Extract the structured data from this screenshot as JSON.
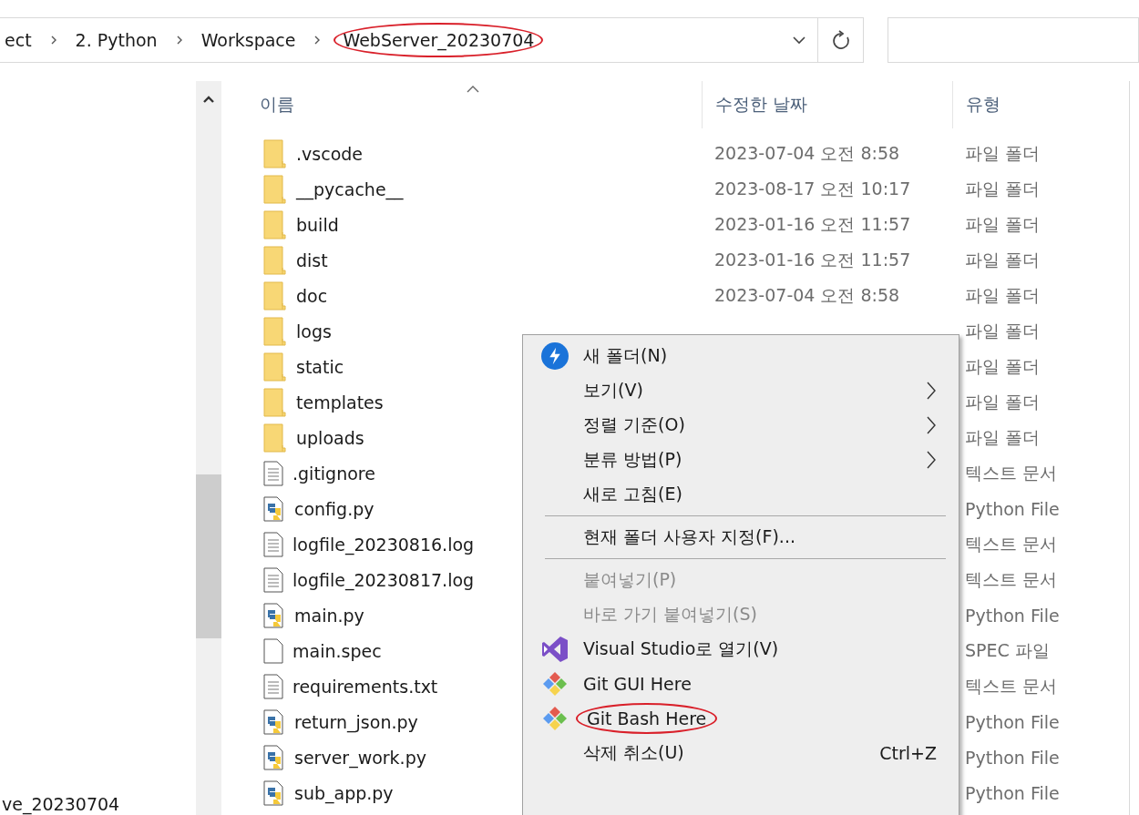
{
  "address_bar": {
    "breadcrumbs": [
      {
        "label": "ect",
        "circled": false
      },
      {
        "label": "2. Python",
        "circled": false
      },
      {
        "label": "Workspace",
        "circled": false
      },
      {
        "label": "WebServer_20230704",
        "circled": true
      }
    ]
  },
  "nav_pane": {
    "items": [
      "ve_20230704"
    ]
  },
  "file_list": {
    "columns": [
      "이름",
      "수정한 날짜",
      "유형"
    ],
    "rows": [
      {
        "kind": "folder",
        "name": ".vscode",
        "modified": "2023-07-04 오전 8:58",
        "type": "파일 폴더"
      },
      {
        "kind": "folder",
        "name": "__pycache__",
        "modified": "2023-08-17 오전 10:17",
        "type": "파일 폴더"
      },
      {
        "kind": "folder",
        "name": "build",
        "modified": "2023-01-16 오전 11:57",
        "type": "파일 폴더"
      },
      {
        "kind": "folder",
        "name": "dist",
        "modified": "2023-01-16 오전 11:57",
        "type": "파일 폴더"
      },
      {
        "kind": "folder",
        "name": "doc",
        "modified": "2023-07-04 오전 8:58",
        "type": "파일 폴더"
      },
      {
        "kind": "folder",
        "name": "logs",
        "type": "파일 폴더"
      },
      {
        "kind": "folder",
        "name": "static",
        "type": "파일 폴더"
      },
      {
        "kind": "folder",
        "name": "templates",
        "type": "파일 폴더"
      },
      {
        "kind": "folder",
        "name": "uploads",
        "type": "파일 폴더"
      },
      {
        "kind": "text",
        "name": ".gitignore",
        "type": "텍스트 문서"
      },
      {
        "kind": "python",
        "name": "config.py",
        "type": "Python File"
      },
      {
        "kind": "text",
        "name": "logfile_20230816.log",
        "type": "텍스트 문서"
      },
      {
        "kind": "text",
        "name": "logfile_20230817.log",
        "type": "텍스트 문서"
      },
      {
        "kind": "python",
        "name": "main.py",
        "type": "Python File"
      },
      {
        "kind": "blank",
        "name": "main.spec",
        "type": "SPEC 파일"
      },
      {
        "kind": "text",
        "name": "requirements.txt",
        "type": "텍스트 문서"
      },
      {
        "kind": "python",
        "name": "return_json.py",
        "type": "Python File"
      },
      {
        "kind": "python",
        "name": "server_work.py",
        "type": "Python File"
      },
      {
        "kind": "python",
        "name": "sub_app.py",
        "type": "Python File"
      }
    ]
  },
  "context_menu": {
    "items": [
      {
        "kind": "lightning-item",
        "label": "새 폴더(N)",
        "disabled": false,
        "submenu": false,
        "circled": false
      },
      {
        "kind": "item",
        "label": "보기(V)",
        "disabled": false,
        "submenu": true,
        "circled": false
      },
      {
        "kind": "item",
        "label": "정렬 기준(O)",
        "disabled": false,
        "submenu": true,
        "circled": false
      },
      {
        "kind": "item",
        "label": "분류 방법(P)",
        "disabled": false,
        "submenu": true,
        "circled": false
      },
      {
        "kind": "item",
        "label": "새로 고침(E)",
        "disabled": false,
        "submenu": false,
        "circled": false
      },
      {
        "kind": "separator"
      },
      {
        "kind": "item",
        "label": "현재 폴더 사용자 지정(F)...",
        "disabled": false,
        "submenu": false,
        "circled": false
      },
      {
        "kind": "separator"
      },
      {
        "kind": "item",
        "label": "붙여넣기(P)",
        "disabled": true,
        "submenu": false,
        "circled": false
      },
      {
        "kind": "item",
        "label": "바로 가기 붙여넣기(S)",
        "disabled": true,
        "submenu": false,
        "circled": false
      },
      {
        "kind": "studio-item",
        "label": "Visual Studio로 열기(V)",
        "disabled": false,
        "submenu": false,
        "circled": false
      },
      {
        "kind": "git-item",
        "label": "Git GUI Here",
        "disabled": false,
        "submenu": false,
        "circled": false
      },
      {
        "kind": "git-item",
        "label": "Git Bash Here",
        "disabled": false,
        "submenu": false,
        "circled": true
      },
      {
        "kind": "item",
        "label": "삭제 취소(U)",
        "shortcut": "Ctrl+Z",
        "disabled": false,
        "submenu": false,
        "circled": false
      }
    ]
  }
}
